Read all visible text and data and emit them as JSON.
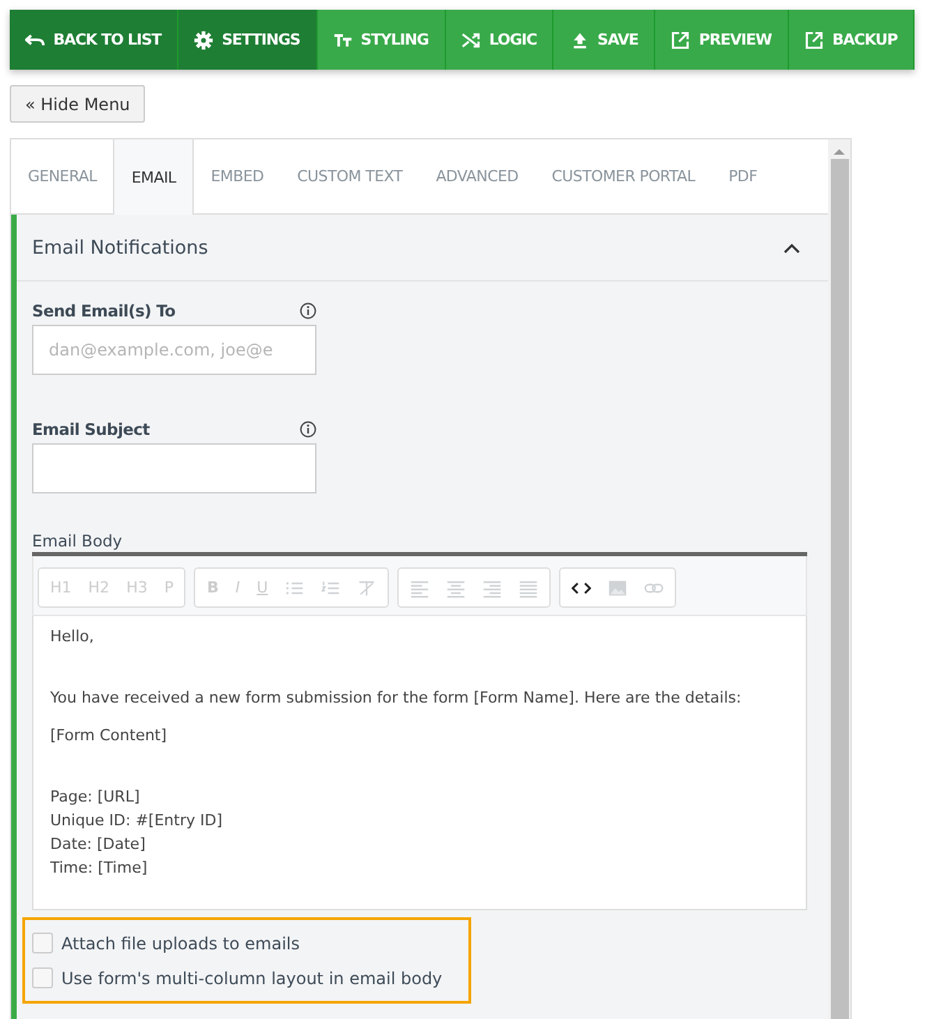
{
  "toolbar": [
    {
      "label": "SETTINGS",
      "kind": "settings",
      "selected": true
    },
    {
      "label": "STYLING",
      "kind": "styling",
      "selected": false
    },
    {
      "label": "LOGIC",
      "kind": "logic",
      "selected": false
    },
    {
      "label": "SAVE",
      "kind": "save",
      "selected": false
    },
    {
      "label": "PREVIEW",
      "kind": "preview",
      "selected": false
    },
    {
      "label": "BACKUP",
      "kind": "backup",
      "selected": false
    }
  ],
  "back_button": "BACK TO LIST",
  "hide_menu": "« Hide Menu",
  "tabs": [
    {
      "label": "GENERAL",
      "selected": false
    },
    {
      "label": "EMAIL",
      "selected": true
    },
    {
      "label": "EMBED",
      "selected": false
    },
    {
      "label": "CUSTOM TEXT",
      "selected": false
    },
    {
      "label": "ADVANCED",
      "selected": false
    },
    {
      "label": "CUSTOMER PORTAL",
      "selected": false
    },
    {
      "label": "PDF",
      "selected": false
    }
  ],
  "section": {
    "title": "Email Notifications",
    "expanded": true
  },
  "fields": [
    {
      "label": "Send Email(s) To",
      "placeholder": "dan@example.com, joe@e"
    },
    {
      "label": "Email Subject"
    }
  ],
  "email_body": {
    "label": "Email Body",
    "toolbar_groups": [
      [
        {
          "kind": "text",
          "label": "H1",
          "disabled": true
        },
        {
          "kind": "text",
          "label": "H2",
          "disabled": true
        },
        {
          "kind": "text",
          "label": "H3",
          "disabled": true
        },
        {
          "kind": "text",
          "label": "P",
          "disabled": true
        }
      ],
      [
        {
          "kind": "bold",
          "label": "B",
          "disabled": true
        },
        {
          "kind": "italic",
          "label": "I",
          "disabled": true
        },
        {
          "kind": "underline",
          "label": "U",
          "disabled": true
        },
        {
          "kind": "bullets",
          "disabled": true
        },
        {
          "kind": "numbers",
          "disabled": true
        },
        {
          "kind": "clear",
          "disabled": true
        }
      ],
      [
        {
          "kind": "left",
          "disabled": true
        },
        {
          "kind": "center",
          "disabled": true
        },
        {
          "kind": "right",
          "disabled": true
        },
        {
          "kind": "justify",
          "disabled": true
        }
      ],
      [
        {
          "kind": "code",
          "disabled": false
        },
        {
          "kind": "image",
          "disabled": true
        },
        {
          "kind": "link",
          "disabled": true
        }
      ]
    ],
    "paragraphs": [
      {
        "lines": [
          "Hello,"
        ],
        "spaced": false
      },
      {
        "lines": [
          "You have received a new form submission for the form [Form Name]. Here are the details:"
        ],
        "spaced": true
      },
      {
        "lines": [
          "[Form Content]"
        ],
        "spaced": false
      },
      {
        "lines": [
          "Page: [URL]",
          "Unique ID: #[Entry ID]",
          "Date: [Date]",
          "Time: [Time]"
        ],
        "spaced": true
      }
    ]
  },
  "options": [
    {
      "label": "Attach file uploads to emails",
      "checked": false
    },
    {
      "label": "Use form's multi-column layout in email body",
      "checked": false
    }
  ]
}
